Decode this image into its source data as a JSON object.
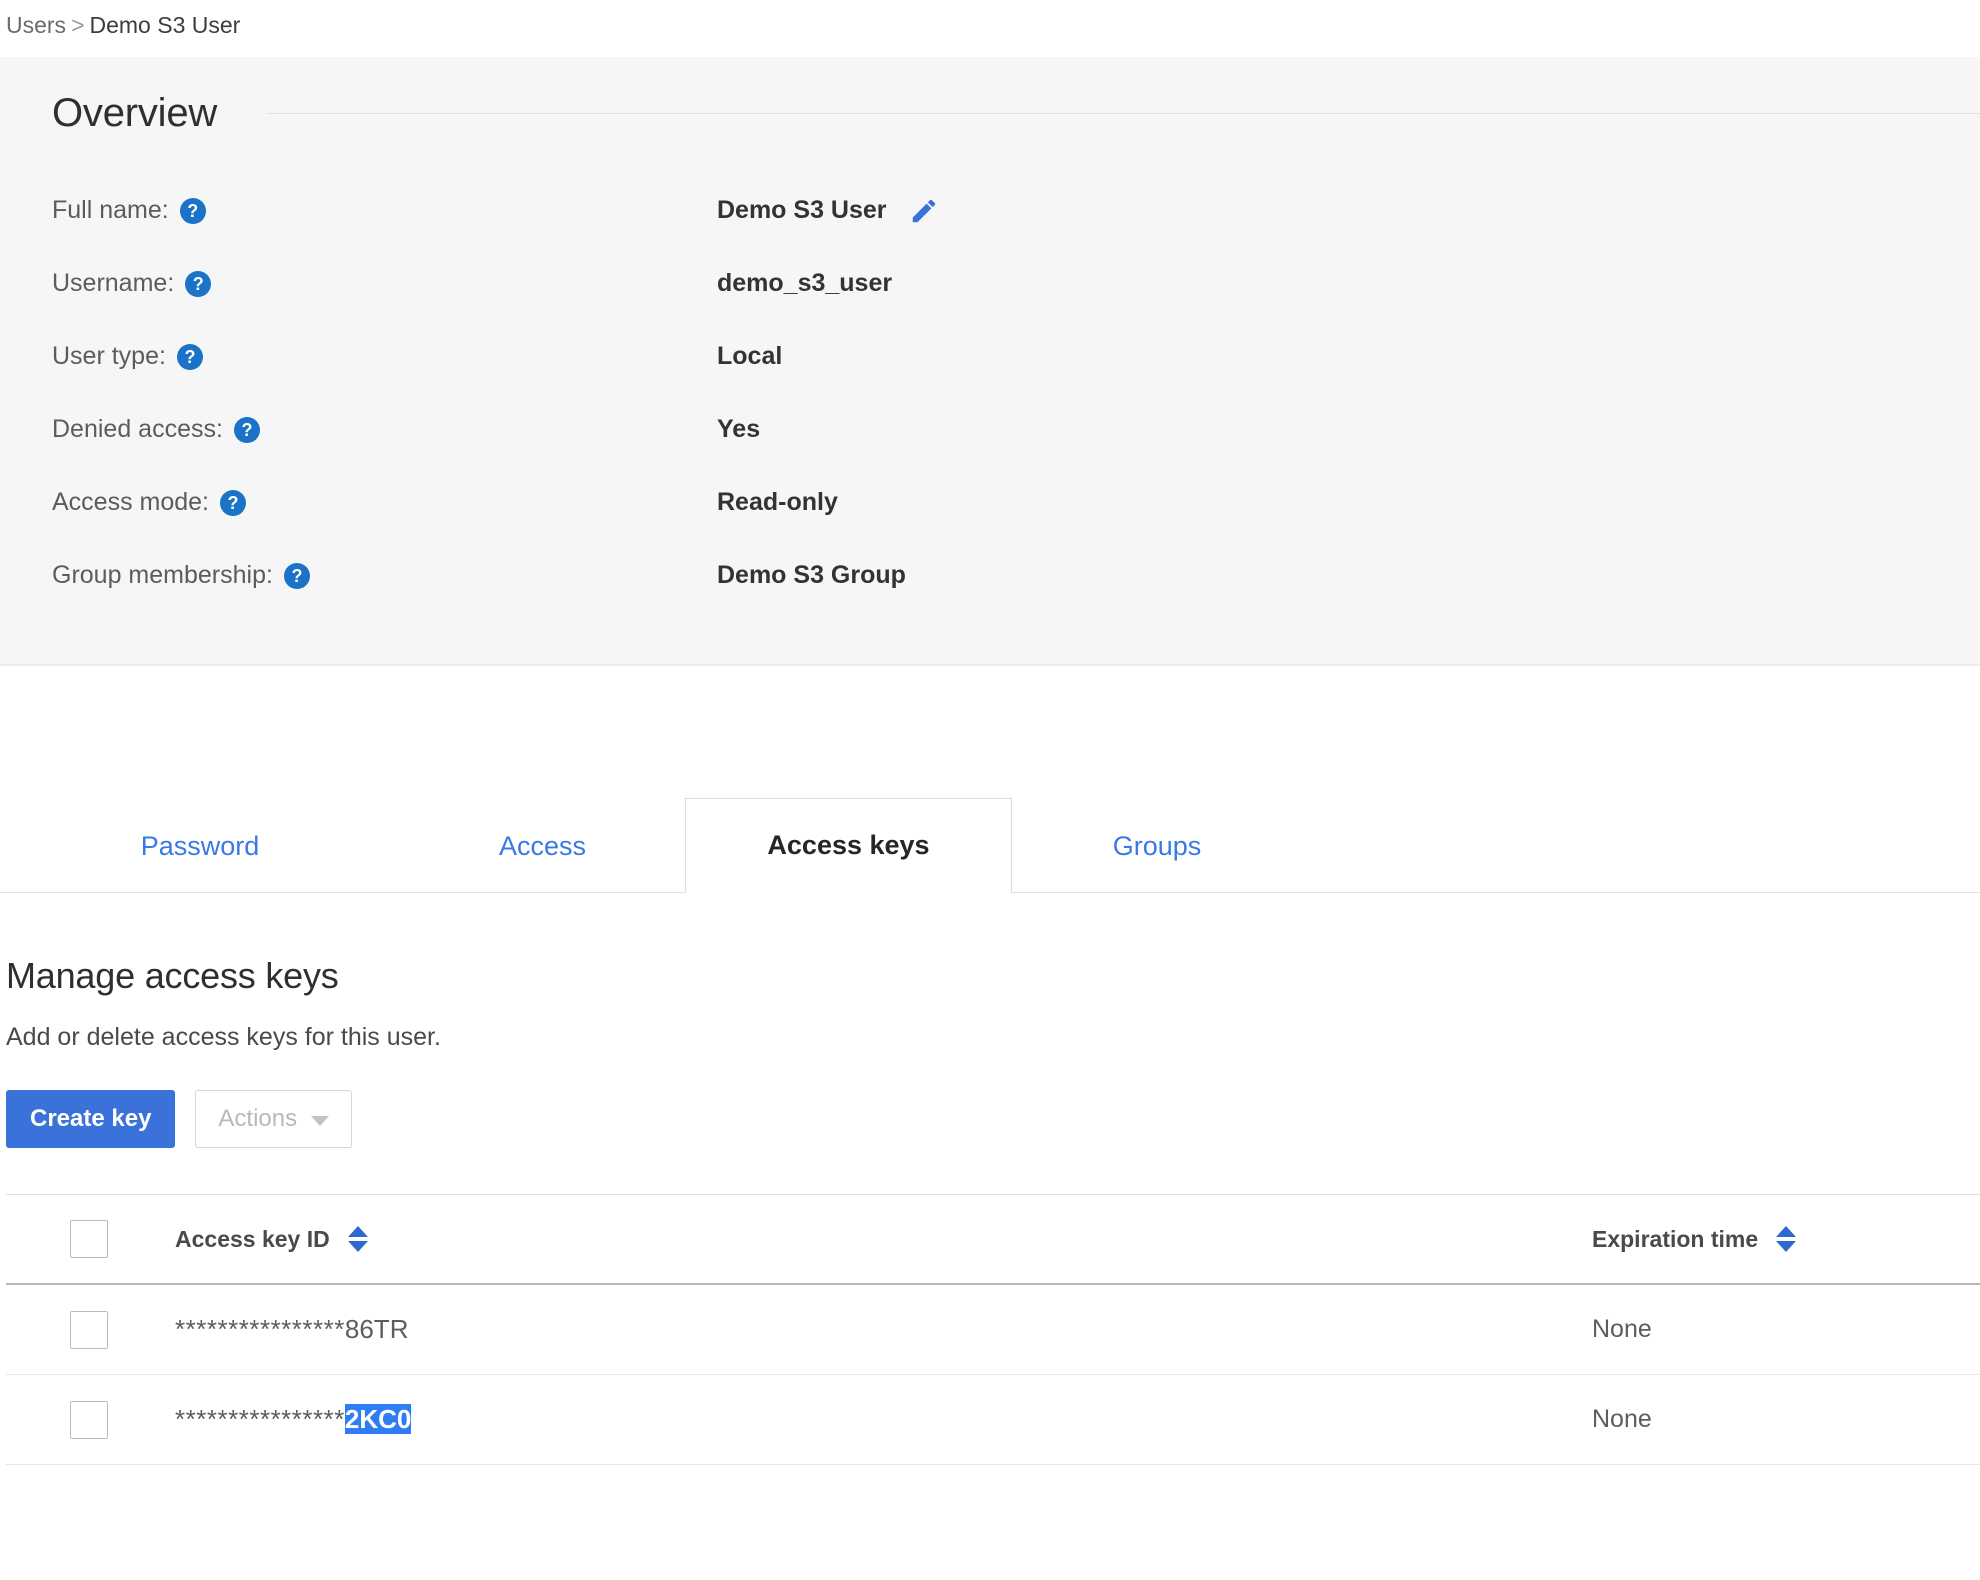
{
  "breadcrumb": {
    "root": "Users",
    "separator": ">",
    "current": "Demo S3 User"
  },
  "overview": {
    "title": "Overview",
    "help_glyph": "?",
    "edit_icon_name": "pencil-icon",
    "rows": [
      {
        "label": "Full name:",
        "value": "Demo S3 User",
        "editable": true
      },
      {
        "label": "Username:",
        "value": "demo_s3_user",
        "editable": false
      },
      {
        "label": "User type:",
        "value": "Local",
        "editable": false
      },
      {
        "label": "Denied access:",
        "value": "Yes",
        "editable": false
      },
      {
        "label": "Access mode:",
        "value": "Read-only",
        "editable": false
      },
      {
        "label": "Group membership:",
        "value": "Demo S3 Group",
        "editable": false
      }
    ]
  },
  "tabs": [
    {
      "label": "Password",
      "active": false
    },
    {
      "label": "Access",
      "active": false
    },
    {
      "label": "Access keys",
      "active": true
    },
    {
      "label": "Groups",
      "active": false
    }
  ],
  "manage": {
    "title": "Manage access keys",
    "subtitle": "Add or delete access keys for this user.",
    "create_button": "Create key",
    "actions_button": "Actions"
  },
  "table": {
    "columns": {
      "access_key_id": "Access key ID",
      "expiration_time": "Expiration time"
    },
    "rows": [
      {
        "mask": "****************",
        "tail": "86TR",
        "selected": false,
        "expiration": "None",
        "checked": false
      },
      {
        "mask": "****************",
        "tail": "2KC0",
        "selected": true,
        "expiration": "None",
        "checked": false
      }
    ]
  },
  "colors": {
    "accent_blue": "#3b72d9",
    "link_blue": "#3b78e7",
    "selection_blue": "#2f7df4",
    "help_blue": "#1a73c7",
    "panel_bg": "#f6f6f6"
  }
}
